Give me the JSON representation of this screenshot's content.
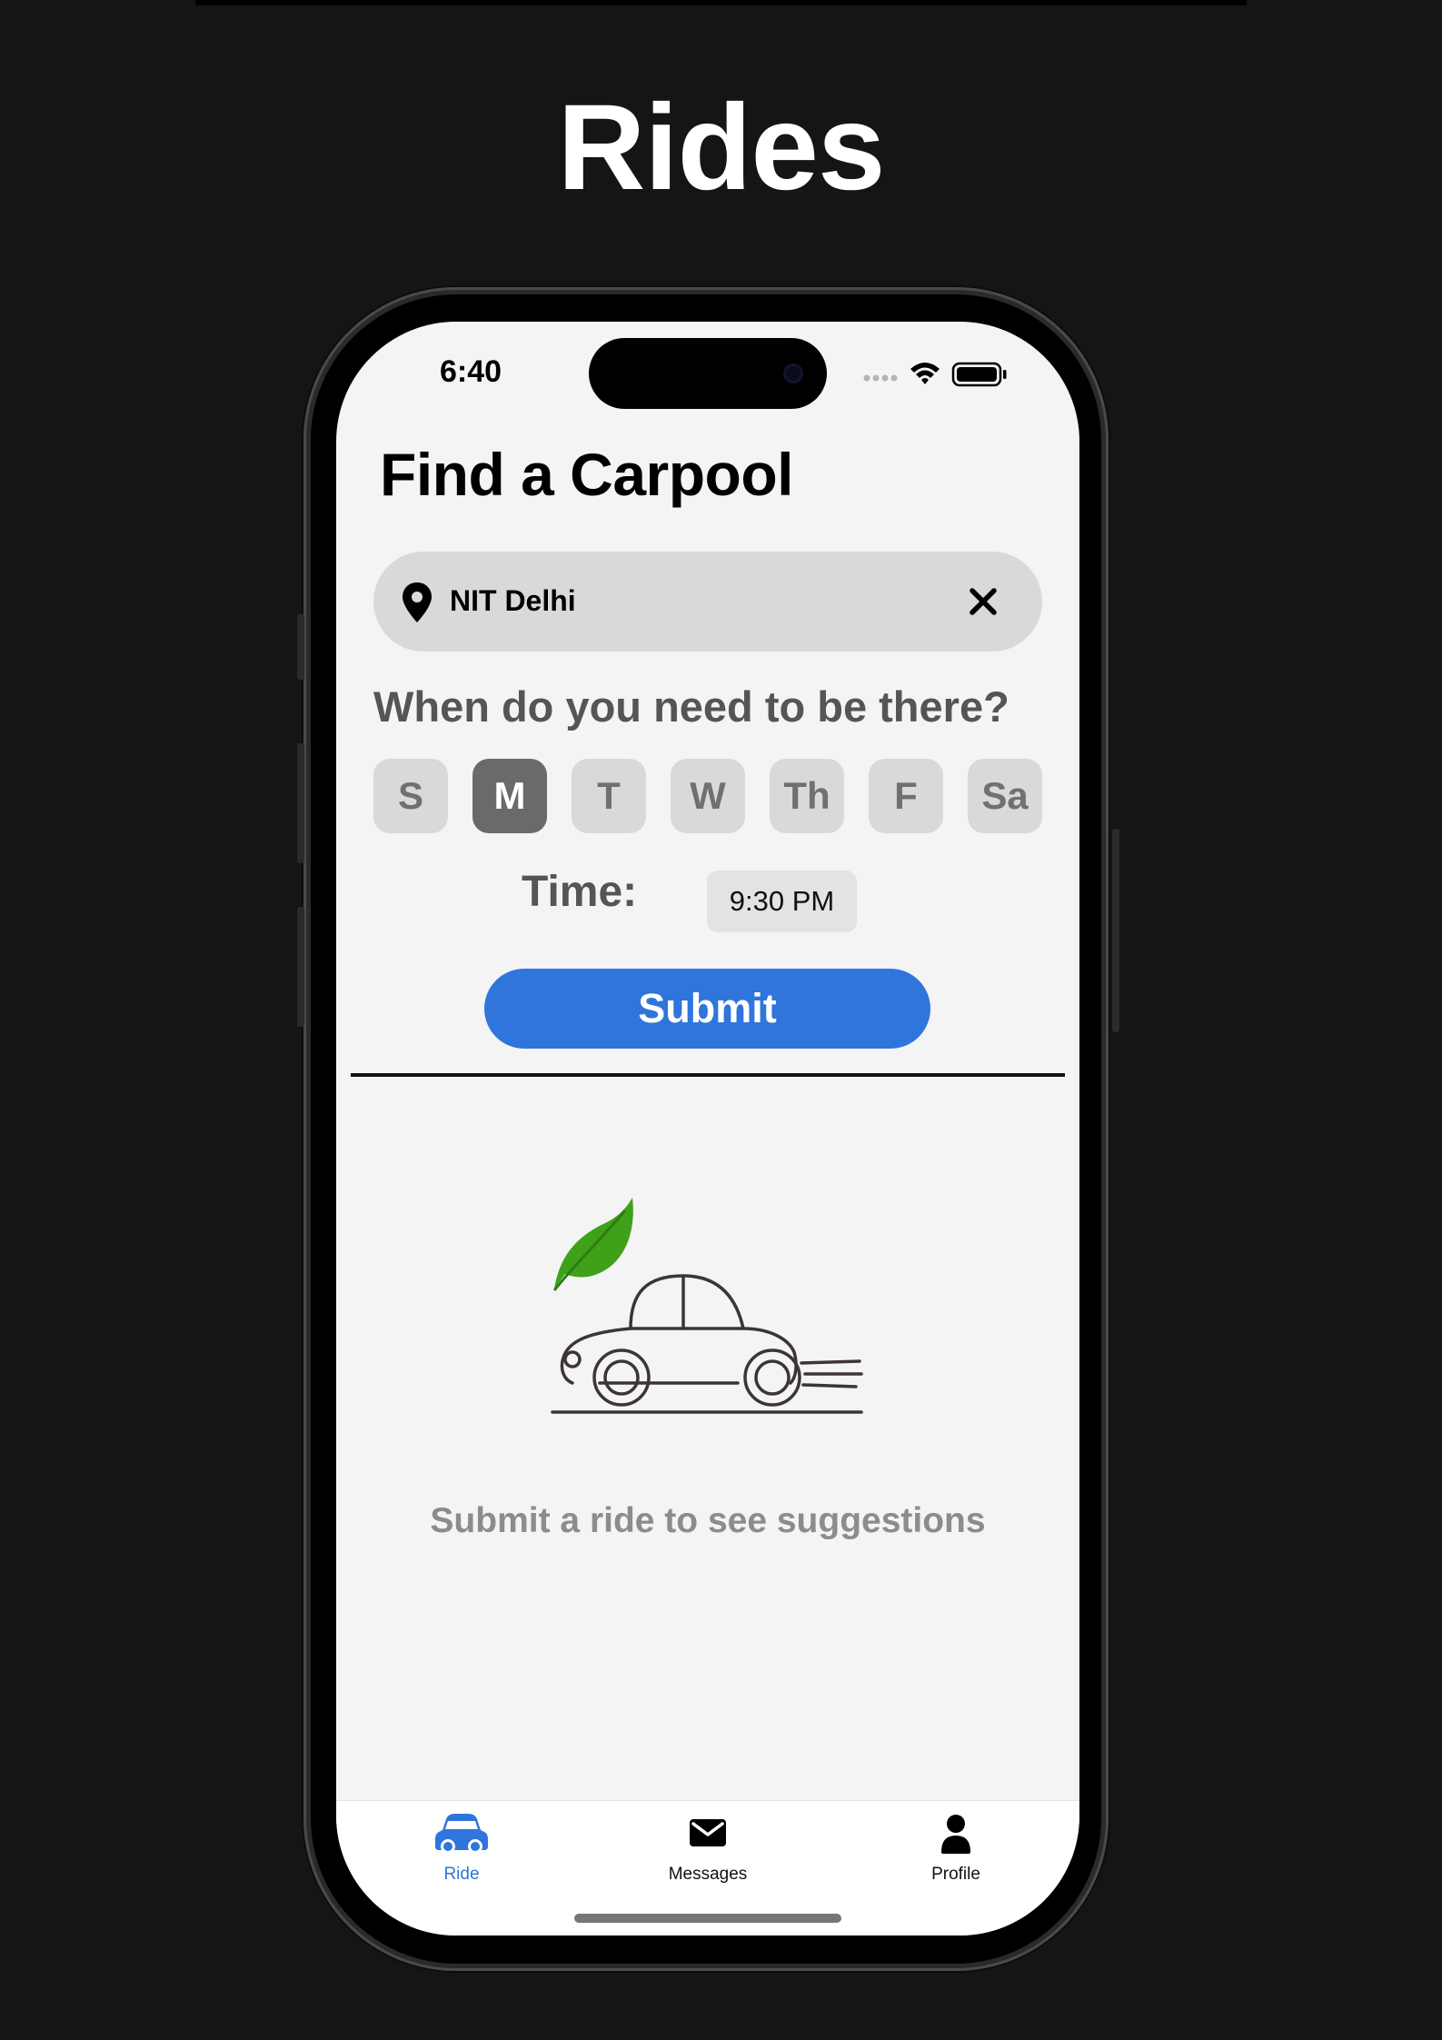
{
  "page_heading": "Rides",
  "status_bar": {
    "time": "6:40"
  },
  "screen": {
    "title": "Find a Carpool",
    "search": {
      "value": "NIT Delhi"
    },
    "question": "When do you need to be there?",
    "days": [
      {
        "label": "S",
        "selected": false
      },
      {
        "label": "M",
        "selected": true
      },
      {
        "label": "T",
        "selected": false
      },
      {
        "label": "W",
        "selected": false
      },
      {
        "label": "Th",
        "selected": false
      },
      {
        "label": "F",
        "selected": false
      },
      {
        "label": "Sa",
        "selected": false
      }
    ],
    "time_label": "Time:",
    "time_value": "9:30 PM",
    "submit_label": "Submit",
    "empty_state_text": "Submit a ride to see suggestions"
  },
  "tabbar": {
    "tabs": [
      {
        "label": "Ride",
        "icon": "car-icon",
        "active": true
      },
      {
        "label": "Messages",
        "icon": "envelope-icon",
        "active": false
      },
      {
        "label": "Profile",
        "icon": "person-icon",
        "active": false
      }
    ]
  },
  "colors": {
    "accent": "#2f75dc",
    "leaf": "#3fa11a",
    "background": "#151515",
    "screen": "#f4f4f4"
  }
}
